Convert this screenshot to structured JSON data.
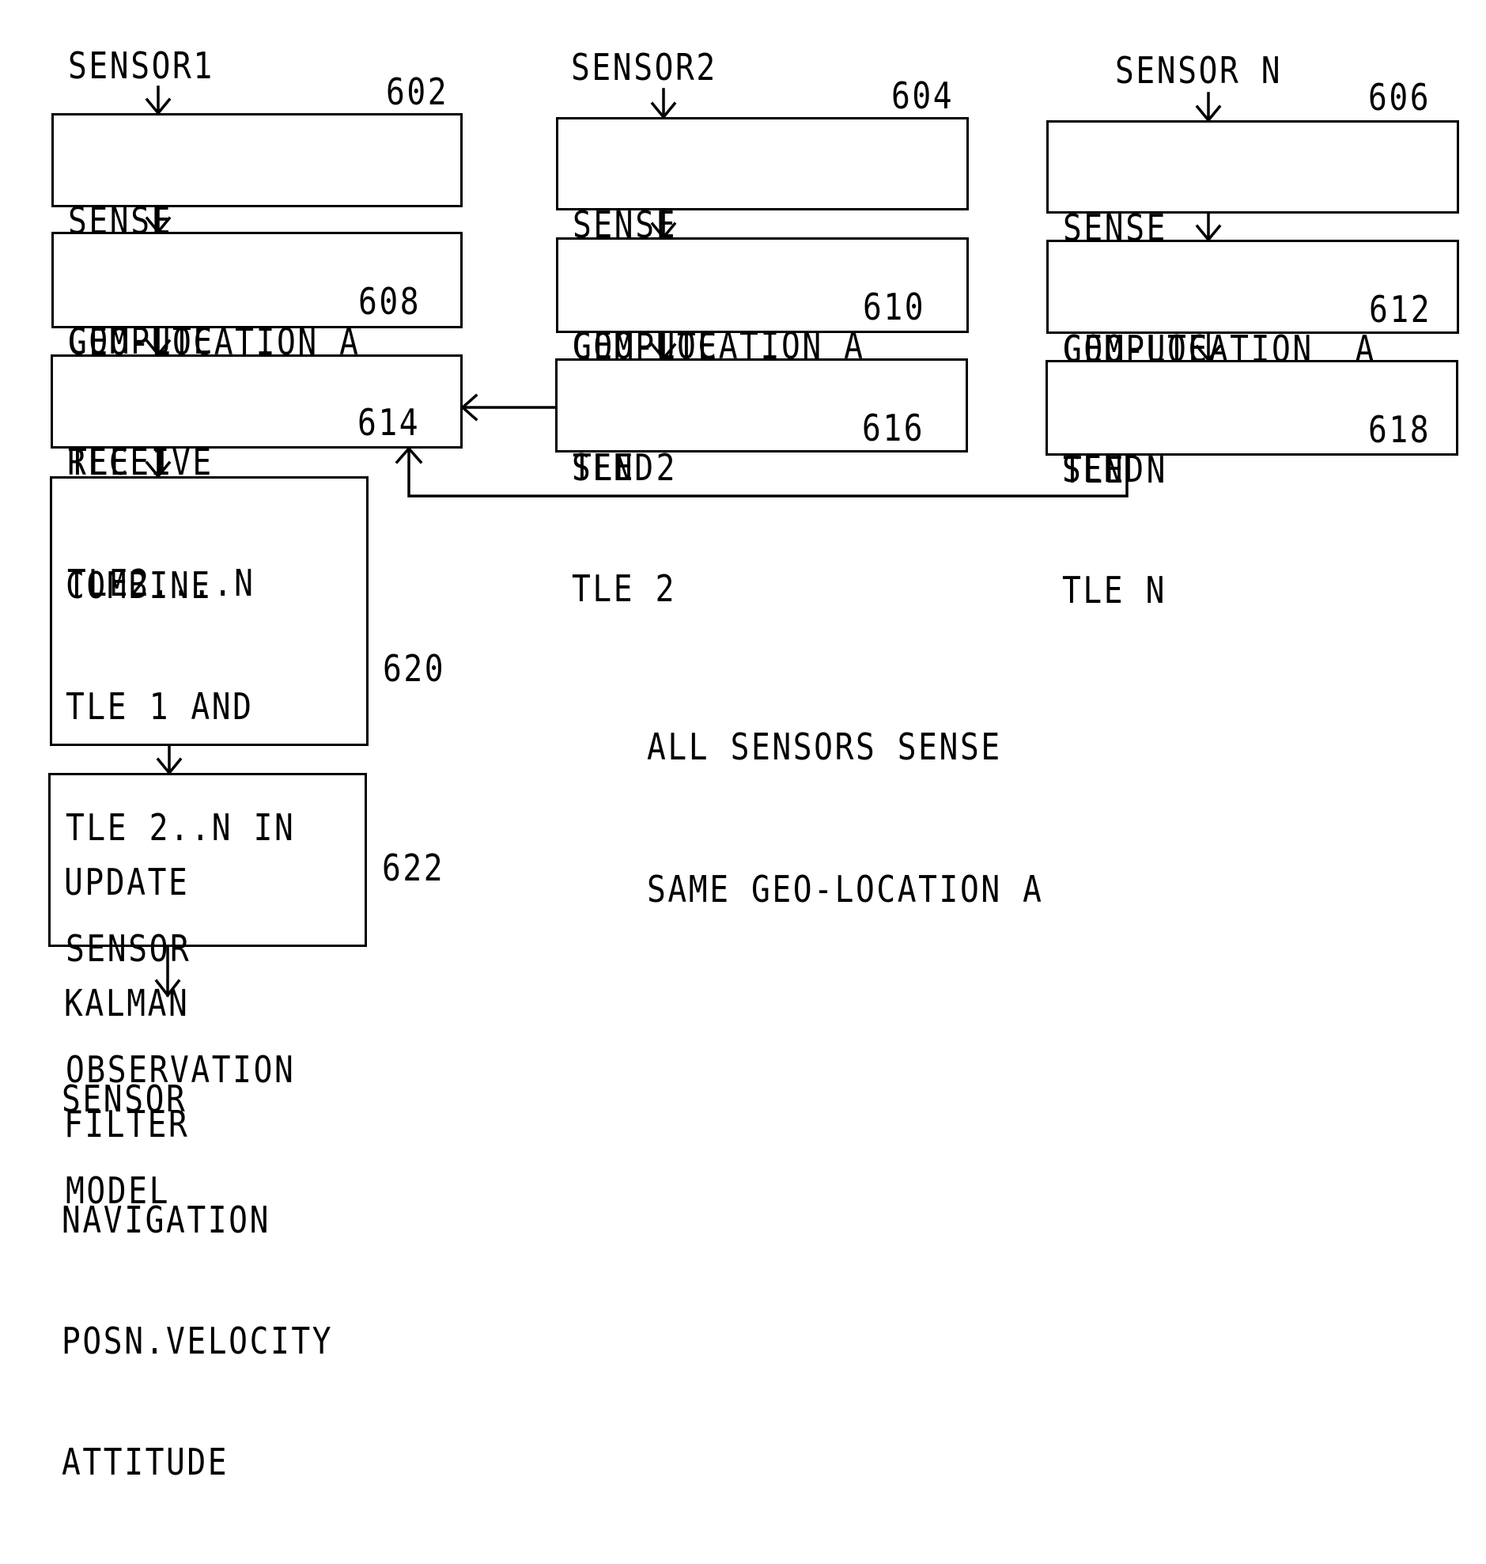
{
  "diagram": {
    "sensors": [
      {
        "label": "SENSOR1",
        "ref": "602"
      },
      {
        "label": "SENSOR2",
        "ref": "604"
      },
      {
        "label": "SENSOR N",
        "ref": "606"
      }
    ],
    "boxes": {
      "sense_1": {
        "lines": [
          "SENSE",
          "GEO-LOCATION A"
        ]
      },
      "sense_2": {
        "lines": [
          "SENSE",
          "GEO-LOCATION A"
        ]
      },
      "sense_n": {
        "lines": [
          "SENSE",
          "GEO-LOCATION  A"
        ]
      },
      "compute_1": {
        "lines": [
          "COMPUTE",
          "TLE 1"
        ],
        "ref": "608"
      },
      "compute_2": {
        "lines": [
          "COMPUTE",
          "TLE 2"
        ],
        "ref": "610"
      },
      "compute_n": {
        "lines": [
          "COMPUTE",
          "TLE N"
        ],
        "ref": "612"
      },
      "receive": {
        "lines": [
          "RECEIVE",
          "TLE2....N"
        ],
        "ref": "614"
      },
      "send_2": {
        "lines": [
          "SEND",
          "TLE 2"
        ],
        "ref": "616"
      },
      "send_n": {
        "lines": [
          "SEND",
          "TLE N"
        ],
        "ref": "618"
      },
      "combine": {
        "lines": [
          "COMBINE",
          "TLE 1 AND",
          "TLE 2..N IN",
          "SENSOR",
          "OBSERVATION",
          "MODEL"
        ],
        "ref": "620"
      },
      "kalman": {
        "lines": [
          "UPDATE",
          "KALMAN",
          "FILTER"
        ],
        "ref": "622"
      }
    },
    "output": {
      "lines": [
        "SENSOR",
        "NAVIGATION",
        "POSN.VELOCITY",
        "ATTITUDE"
      ]
    },
    "note": {
      "lines": [
        "ALL SENSORS SENSE",
        "SAME GEO-LOCATION A"
      ]
    }
  }
}
